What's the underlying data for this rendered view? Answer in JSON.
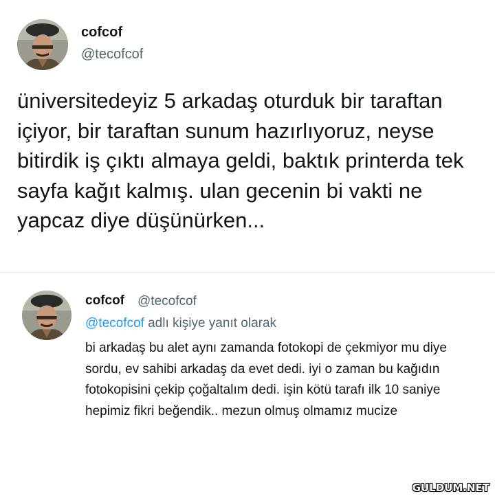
{
  "tweet": {
    "display_name": "cofcof",
    "handle": "@tecofcof",
    "text": "üniversitedeyiz 5 arkadaş oturduk bir taraftan içiyor, bir taraftan sunum hazırlıyoruz, neyse bitirdik iş çıktı almaya geldi, baktık printerda tek sayfa kağıt kalmış. ulan gecenin bi vakti ne yapcaz diye düşünürken..."
  },
  "reply": {
    "display_name": "cofcof",
    "handle": "@tecofcof",
    "reply_mention": "@tecofcof",
    "reply_suffix": " adlı kişiye yanıt olarak",
    "text": "bi arkadaş bu alet aynı zamanda fotokopi de çekmiyor mu diye sordu, ev sahibi arkadaş da evet dedi. iyi o zaman bu kağıdın fotokopisini çekip çoğaltalım dedi. işin kötü tarafı ilk 10 saniye hepimiz fikri beğendik.. mezun olmuş olmamız mucize"
  },
  "watermark": "GULDUM.NET",
  "colors": {
    "text": "#0f1419",
    "secondary": "#536471",
    "link": "#1d9bf0"
  }
}
